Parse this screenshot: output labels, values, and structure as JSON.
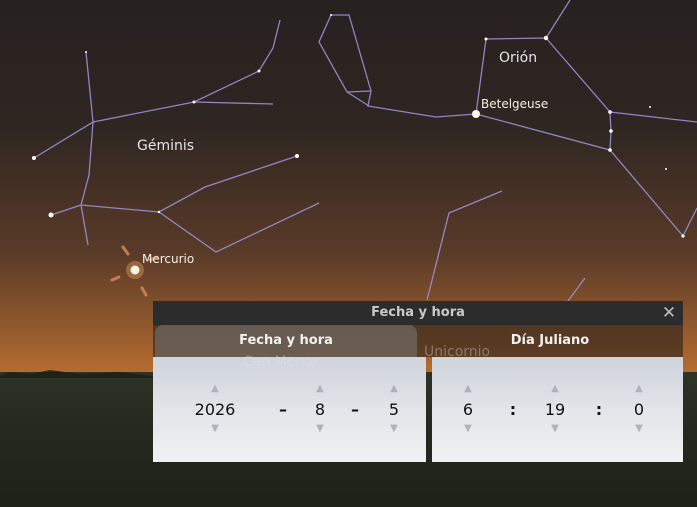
{
  "sky_labels": {
    "gemini": "Géminis",
    "orion": "Orión",
    "betelgeuse": "Betelgeuse",
    "mercury": "Mercurio",
    "canis_minor": "Can Menor",
    "monoceros": "Unicornio"
  },
  "dialog": {
    "title": "Fecha y hora",
    "close_icon": "close-icon",
    "tabs": [
      {
        "label": "Fecha y hora",
        "active": true
      },
      {
        "label": "Día Juliano",
        "active": false
      }
    ],
    "date": {
      "year": "2026",
      "month": "8",
      "day": "5",
      "separator": "–"
    },
    "time": {
      "hour": "6",
      "minute": "19",
      "second": "0",
      "separator": ":"
    }
  },
  "colors": {
    "constellation_line": "#9d8fd6",
    "dialog_header": "#2c2c2c",
    "panel": "#e3e6ea"
  }
}
